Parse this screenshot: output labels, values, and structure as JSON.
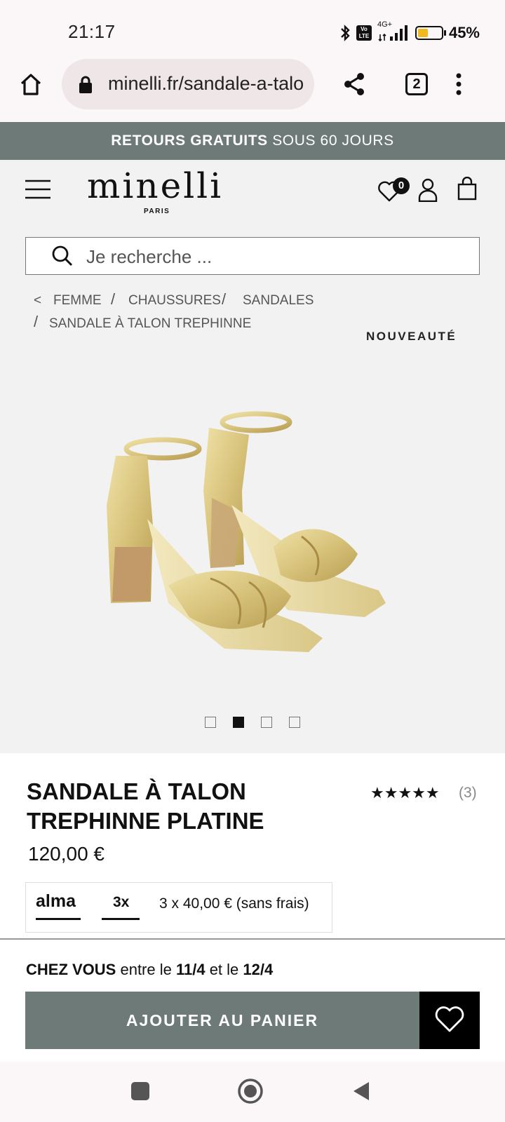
{
  "status_bar": {
    "time": "21:17",
    "network": "4G+",
    "volte": "Vo LTE",
    "battery": "45%",
    "battery_level": 0.45,
    "icons": [
      "bluetooth-icon",
      "volte-icon",
      "signal-icon",
      "battery-icon"
    ]
  },
  "browser": {
    "url": "minelli.fr/sandale-a-talon-trephinne",
    "tab_count": "2",
    "icons": [
      "home-icon",
      "lock-icon",
      "share-icon",
      "tabs-icon",
      "more-icon"
    ]
  },
  "promo": {
    "bold": "RETOURS GRATUITS",
    "rest": " SOUS 60 JOURS",
    "bg": "#6d7a77"
  },
  "header": {
    "logo": "minelli",
    "logo_sub": "PARIS",
    "wishlist_count": "0",
    "icons": [
      "menu-icon",
      "heart-icon",
      "account-icon",
      "bag-icon"
    ]
  },
  "search": {
    "placeholder": "Je recherche ..."
  },
  "breadcrumb": {
    "back": "<",
    "items": [
      "FEMME",
      "CHAUSSURES",
      "SANDALES",
      "SANDALE À TALON TREPHINNE"
    ],
    "separator": "/"
  },
  "product": {
    "tag": "NOUVEAUTÉ",
    "title": "SANDALE À TALON TREPHINNE PLATINE",
    "rating_stars": "★★★★★",
    "rating": 5,
    "reviews": "(3)",
    "price": "120,00 €",
    "image_active_index": 2,
    "image_count": 4
  },
  "alma": {
    "logo": "alma",
    "plan": "3x",
    "text": "3 x 40,00 € (sans frais)"
  },
  "delivery": {
    "label": "CHEZ VOUS",
    "mid1": " entre le ",
    "date1": "11/4",
    "mid2": " et le ",
    "date2": "12/4"
  },
  "cta": {
    "add_to_cart": "AJOUTER AU PANIER",
    "accent": "#6d7a77"
  },
  "system_nav": {
    "icons": [
      "recents-icon",
      "home-circle-icon",
      "back-icon"
    ]
  }
}
